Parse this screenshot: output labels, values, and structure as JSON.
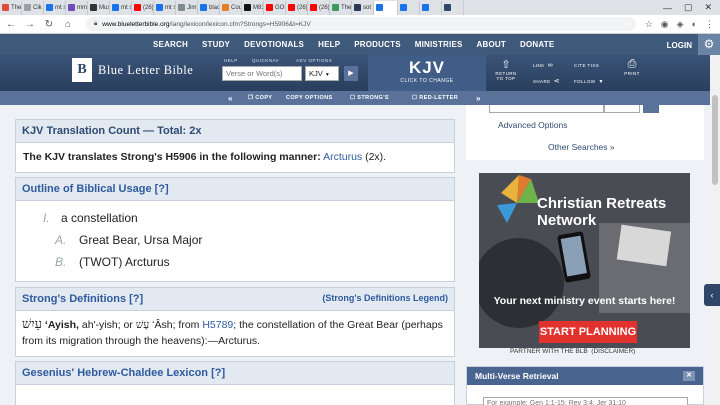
{
  "browser": {
    "tabs": [
      "The",
      "Cik",
      "mt s",
      "mm",
      "Mus",
      "mt s",
      "(26)",
      "mt s",
      "Jim",
      "blac",
      "Cou",
      "M81",
      "GOI",
      "(26)",
      "(26)",
      "The",
      "sot",
      "",
      "",
      "",
      ""
    ],
    "tab_colors": [
      "#e04b3b",
      "#9aa0a6",
      "#1a73e8",
      "#6b4fbb",
      "#333333",
      "#1a73e8",
      "#ff0000",
      "#1a73e8",
      "#7f8c8d",
      "#1a73e8",
      "#e67e22",
      "#111111",
      "#ff0000",
      "#ff0000",
      "#ff0000",
      "#3c9a5f",
      "#2b3a55",
      "#1a73e8",
      "#1a73e8",
      "#1a73e8",
      "#2f4668"
    ],
    "url_domain": "www.blueletterbible.org",
    "url_path": "/lang/lexicon/lexicon.cfm?Strongs=H5906&t=KJV"
  },
  "topnav": {
    "items": [
      "SEARCH",
      "STUDY",
      "DEVOTIONALS",
      "HELP",
      "PRODUCTS",
      "MINISTRIES",
      "ABOUT",
      "DONATE"
    ],
    "login": "LOGIN"
  },
  "header": {
    "logo_text": "Blue Letter Bible",
    "help": "HELP",
    "quicknav": "QUICKNAV",
    "adv_options": "ADV OPTIONS",
    "verse_placeholder": "Verse or Word(s)",
    "version": "KJV",
    "kjv_big": "KJV",
    "kjv_small": "CLICK TO CHANGE",
    "return_top": "RETURN TO TOP",
    "link": "LINK",
    "cite": "CITE THIS",
    "share": "SHARE",
    "follow": "FOLLOW",
    "print": "PRINT"
  },
  "toolbar": {
    "copy": "COPY",
    "copy_options": "COPY OPTIONS",
    "strongs": "STRONG'S",
    "red_letter": "RED-LETTER"
  },
  "translation_count": {
    "title": "KJV Translation Count — Total: 2x",
    "lead": "The KJV translates Strong's H5906 in the following manner:",
    "word": "Arcturus",
    "count": "(2x)."
  },
  "outline": {
    "title": "Outline of Biblical Usage [?]",
    "items": [
      {
        "marker": "I.",
        "text": "a constellation"
      },
      {
        "marker": "A.",
        "text": "Great Bear, Ursa Major"
      },
      {
        "marker": "B.",
        "text": "(TWOT) Arcturus"
      }
    ]
  },
  "strongs_def": {
    "title": "Strong's Definitions [?]",
    "legend": "(Strong's Definitions Legend)",
    "hebrew": "עַיִשׁ",
    "translit": "ʻAyish,",
    "pron": "ah'-yish; or",
    "alt_hebrew": "עָשׁ",
    "alt": "ʻÂsh; from",
    "ref": "H5789",
    "rest": "; the constellation of the Great Bear (perhaps from its migration through the heavens):—Arcturus."
  },
  "gesenius": {
    "title": "Gesenius' Hebrew-Chaldee Lexicon [?]"
  },
  "sidebar": {
    "advanced": "Advanced Options",
    "other": "Other Searches",
    "ad_title": "Christian Retreats Network",
    "ad_line": "Your next ministry event starts here!",
    "ad_button": "START PLANNING",
    "ad_partner": "PARTNER WITH THE BLB",
    "ad_disclaimer": "(DISCLAIMER)",
    "mvr_title": "Multi-Verse Retrieval",
    "mvr_placeholder": "For example: Gen 1:1-15; Rev 3:4; Jer 31:10"
  }
}
